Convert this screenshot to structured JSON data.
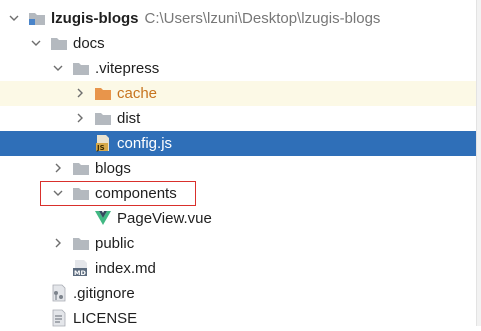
{
  "tree": {
    "root": {
      "name": "lzugis-blogs",
      "path": "C:\\Users\\lzuni\\Desktop\\lzugis-blogs"
    },
    "items": [
      {
        "label": "docs"
      },
      {
        "label": ".vitepress"
      },
      {
        "label": "cache"
      },
      {
        "label": "dist"
      },
      {
        "label": "config.js"
      },
      {
        "label": "blogs"
      },
      {
        "label": "components"
      },
      {
        "label": "PageView.vue"
      },
      {
        "label": "public"
      },
      {
        "label": "index.md"
      },
      {
        "label": ".gitignore"
      },
      {
        "label": "LICENSE"
      }
    ],
    "selected": "config.js",
    "highlighted": "components"
  },
  "colors": {
    "selection": "#2f6fb8",
    "hover_row": "#fcf9e6",
    "folder": "#b4b9bf",
    "excluded_folder": "#e8954b",
    "vue_logo": "#41b883",
    "js_badge": "#d6a94a",
    "highlight_box": "#d9302c"
  },
  "icons": {
    "folder": "folder-icon",
    "excluded_folder": "folder-orange-icon",
    "js_file": "js-file-icon",
    "vue_file": "vue-file-icon",
    "markdown_file": "md-file-icon",
    "gitignore_file": "gitignore-file-icon",
    "text_file": "text-file-icon",
    "expanded": "chevron-down-icon",
    "collapsed": "chevron-right-icon"
  }
}
